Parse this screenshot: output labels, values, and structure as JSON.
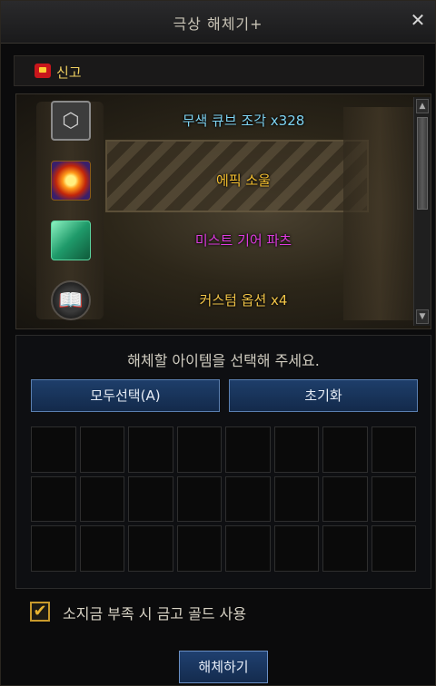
{
  "window": {
    "title": "극상 해체기+",
    "close_symbol": "✕"
  },
  "report": {
    "label": "신고",
    "icon": "report-siren-icon"
  },
  "results": [
    {
      "name": "무색 큐브 조각 x328",
      "color": "#7fd4f2",
      "icon": "colorless-cube-icon"
    },
    {
      "name": "에픽 소울",
      "color": "#f5c030",
      "icon": "epic-soul-icon"
    },
    {
      "name": "미스트 기어 파츠",
      "color": "#e03ce0",
      "icon": "mist-gear-parts-icon"
    },
    {
      "name": "커스텀 옵션 x4",
      "color": "#f2c548",
      "icon": "custom-option-book-icon"
    }
  ],
  "instruction": "해체할 아이템을 선택해 주세요.",
  "buttons": {
    "select_all": "모두선택(A)",
    "reset": "초기화",
    "dismantle": "해체하기"
  },
  "gold_option": {
    "label": "소지금 부족 시 금고 골드 사용",
    "checked": true,
    "check_symbol": "✔"
  },
  "slots": {
    "rows": 3,
    "cols": 8
  }
}
